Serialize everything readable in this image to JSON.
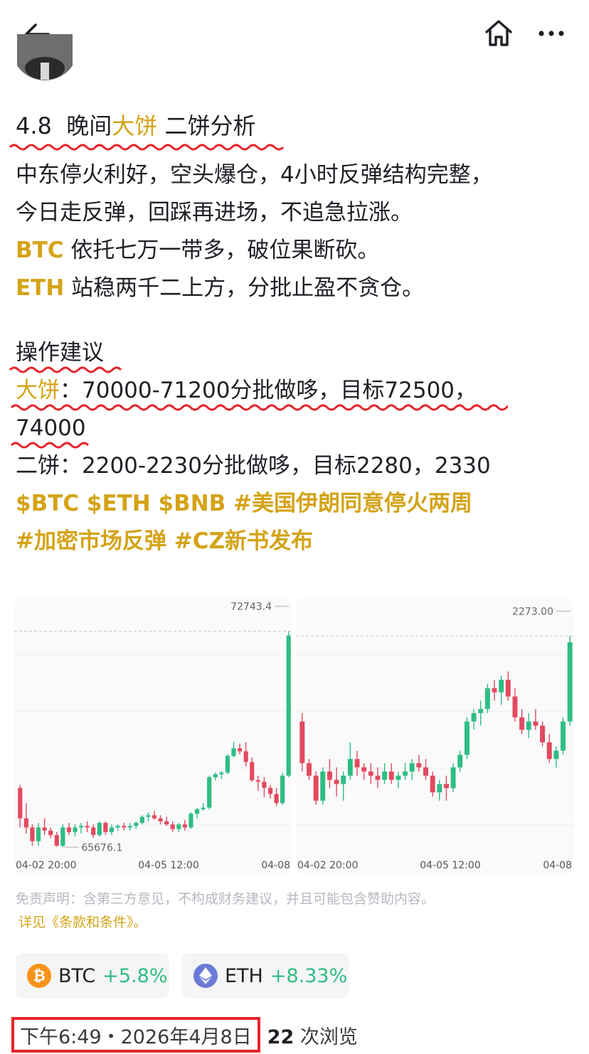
{
  "post": {
    "title_prefix": "4.8  晚间",
    "title_highlight": "大饼",
    "title_suffix": " 二饼分析",
    "lines": [
      "中东停火利好，空头爆仓，4小时反弹结构完整，",
      "今日走反弹，回踩再进场，不追急拉涨。"
    ],
    "btc_label": "BTC",
    "btc_text": " 依托七万一带多，破位果断砍。",
    "eth_label": "ETH",
    "eth_text": " 站稳两千二上方，分批止盈不贪仓。",
    "ops_title": "操作建议",
    "op1_label": "大饼",
    "op1_text": "：70000-71200分批做哆，目标72500，",
    "op1_text2": "74000",
    "op2_text": "二饼：2200-2230分批做哆，目标2280，2330",
    "tags_line1": "$BTC $ETH $BNB #美国伊朗同意停火两周",
    "tags_line2": "#加密市场反弹 #CZ新书发布"
  },
  "chart_data": [
    {
      "type": "candlestick",
      "title": "",
      "x_ticks": [
        "04-02 20:00",
        "04-05 12:00",
        "04-08"
      ],
      "max_label": "72743.4",
      "min_label": "65676.1",
      "ylim": [
        65400,
        73200
      ],
      "ohlc": [
        [
          67600,
          67700,
          66300,
          66600
        ],
        [
          66600,
          67100,
          66100,
          66300
        ],
        [
          66300,
          66400,
          65700,
          65850
        ],
        [
          65850,
          66450,
          65700,
          66300
        ],
        [
          66300,
          66600,
          66050,
          66200
        ],
        [
          66200,
          66300,
          65950,
          66050
        ],
        [
          66050,
          66150,
          65676.1,
          65700
        ],
        [
          65700,
          66400,
          65650,
          66300
        ],
        [
          66300,
          66450,
          66050,
          66150
        ],
        [
          66150,
          66400,
          66000,
          66300
        ],
        [
          66300,
          66450,
          66100,
          66350
        ],
        [
          66350,
          66500,
          66150,
          66300
        ],
        [
          66300,
          66400,
          65950,
          66050
        ],
        [
          66050,
          66500,
          66000,
          66450
        ],
        [
          66450,
          66500,
          66050,
          66150
        ],
        [
          66150,
          66400,
          66050,
          66300
        ],
        [
          66300,
          66400,
          66200,
          66350
        ],
        [
          66350,
          66450,
          66200,
          66300
        ],
        [
          66300,
          66450,
          66200,
          66350
        ],
        [
          66350,
          66500,
          66250,
          66450
        ],
        [
          66450,
          66700,
          66400,
          66650
        ],
        [
          66650,
          66800,
          66500,
          66700
        ],
        [
          66700,
          66850,
          66550,
          66600
        ],
        [
          66600,
          66700,
          66400,
          66500
        ],
        [
          66500,
          66650,
          66350,
          66400
        ],
        [
          66400,
          66500,
          66150,
          66250
        ],
        [
          66250,
          66450,
          66150,
          66400
        ],
        [
          66400,
          66550,
          66200,
          66300
        ],
        [
          66300,
          66800,
          66250,
          66750
        ],
        [
          66750,
          66950,
          66600,
          66900
        ],
        [
          66900,
          67100,
          66850,
          66950
        ],
        [
          66950,
          68000,
          66900,
          67950
        ],
        [
          67950,
          68100,
          67850,
          68050
        ],
        [
          68050,
          68150,
          67900,
          68100
        ],
        [
          68100,
          68700,
          68050,
          68650
        ],
        [
          68650,
          69100,
          68600,
          68900
        ],
        [
          68900,
          69050,
          68700,
          68800
        ],
        [
          68800,
          69100,
          68300,
          68450
        ],
        [
          68450,
          68600,
          67800,
          67850
        ],
        [
          67850,
          68000,
          67500,
          67800
        ],
        [
          67800,
          67950,
          67300,
          67600
        ],
        [
          67600,
          67700,
          67250,
          67400
        ],
        [
          67400,
          67600,
          67000,
          67100
        ],
        [
          67100,
          68100,
          67050,
          68000
        ],
        [
          68000,
          72743.4,
          67950,
          72600
        ]
      ]
    },
    {
      "type": "candlestick",
      "title": "",
      "x_ticks": [
        "04-02 20:00",
        "04-05 12:00",
        "04-08"
      ],
      "max_label": "2273.00",
      "ylim": [
        2010,
        2295
      ],
      "ohlc": [
        [
          2170,
          2180,
          2110,
          2120
        ],
        [
          2120,
          2125,
          2100,
          2105
        ],
        [
          2105,
          2110,
          2070,
          2075
        ],
        [
          2075,
          2115,
          2070,
          2110
        ],
        [
          2110,
          2125,
          2090,
          2100
        ],
        [
          2100,
          2115,
          2080,
          2095
        ],
        [
          2095,
          2110,
          2075,
          2105
        ],
        [
          2105,
          2145,
          2100,
          2125
        ],
        [
          2125,
          2135,
          2105,
          2115
        ],
        [
          2115,
          2120,
          2100,
          2110
        ],
        [
          2110,
          2120,
          2095,
          2105
        ],
        [
          2105,
          2115,
          2090,
          2100
        ],
        [
          2100,
          2120,
          2095,
          2110
        ],
        [
          2110,
          2120,
          2095,
          2100
        ],
        [
          2100,
          2110,
          2090,
          2105
        ],
        [
          2105,
          2120,
          2100,
          2110
        ],
        [
          2110,
          2125,
          2100,
          2120
        ],
        [
          2120,
          2130,
          2110,
          2115
        ],
        [
          2115,
          2125,
          2100,
          2105
        ],
        [
          2105,
          2110,
          2080,
          2085
        ],
        [
          2085,
          2100,
          2075,
          2095
        ],
        [
          2095,
          2105,
          2075,
          2090
        ],
        [
          2090,
          2120,
          2085,
          2115
        ],
        [
          2115,
          2135,
          2110,
          2130
        ],
        [
          2130,
          2175,
          2125,
          2170
        ],
        [
          2170,
          2185,
          2160,
          2180
        ],
        [
          2180,
          2195,
          2165,
          2185
        ],
        [
          2185,
          2215,
          2180,
          2210
        ],
        [
          2210,
          2220,
          2195,
          2205
        ],
        [
          2205,
          2225,
          2190,
          2220
        ],
        [
          2220,
          2230,
          2195,
          2200
        ],
        [
          2200,
          2210,
          2170,
          2175
        ],
        [
          2175,
          2185,
          2155,
          2160
        ],
        [
          2160,
          2180,
          2150,
          2170
        ],
        [
          2170,
          2185,
          2160,
          2165
        ],
        [
          2165,
          2170,
          2140,
          2145
        ],
        [
          2145,
          2155,
          2120,
          2125
        ],
        [
          2125,
          2140,
          2115,
          2135
        ],
        [
          2135,
          2175,
          2130,
          2170
        ],
        [
          2170,
          2272.5,
          2165,
          2265
        ]
      ]
    }
  ],
  "disclaimer": "免责声明：含第三方意见，不构成财务建议，并且可能包含赞助内容。",
  "terms": "详见《条款和条件》。",
  "chips": [
    {
      "symbol": "BTC",
      "change": "+5.8%",
      "color": "#f7931a"
    },
    {
      "symbol": "ETH",
      "change": "+8.33%",
      "color": "#6b7ad6"
    }
  ],
  "footer": {
    "datetime": "下午6:49・2026年4月8日",
    "views_count": "22",
    "views_label": " 次浏览"
  },
  "icons": {
    "back": "arrow-left-icon",
    "home": "home-icon",
    "more": "more-dots-icon",
    "btc": "bitcoin-icon",
    "eth": "ethereum-icon"
  },
  "colors": {
    "accent": "#d4a317",
    "up": "#2ebd85",
    "down": "#e24a5f",
    "annotation": "#e8232a"
  }
}
